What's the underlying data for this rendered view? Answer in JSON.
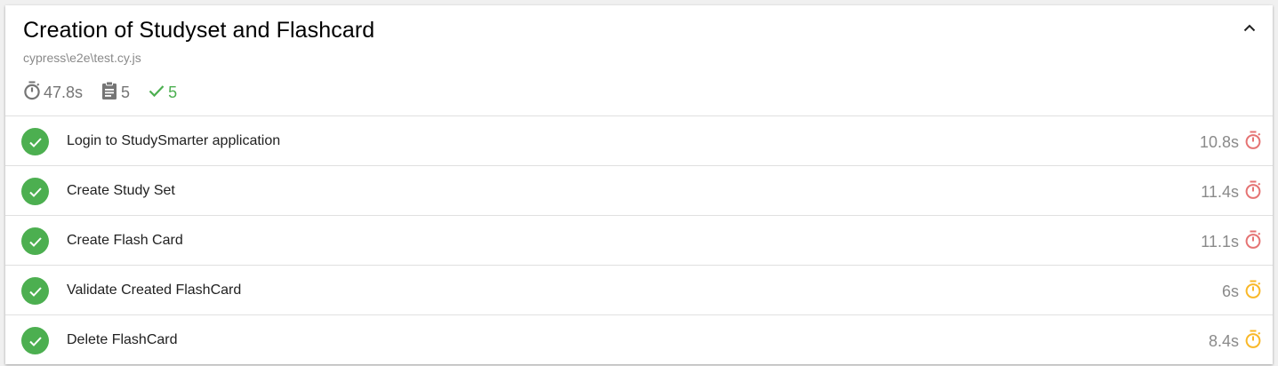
{
  "suite": {
    "title": "Creation of Studyset and Flashcard",
    "file": "cypress\\e2e\\test.cy.js",
    "duration": "47.8s",
    "test_count": "5",
    "passed_count": "5"
  },
  "colors": {
    "pass": "#4caf50",
    "slow": "#e57373",
    "medium": "#f9b828",
    "muted": "#757575"
  },
  "tests": [
    {
      "title": "Login to StudySmarter application",
      "duration": "10.8s",
      "speed": "slow"
    },
    {
      "title": "Create Study Set",
      "duration": "11.4s",
      "speed": "slow"
    },
    {
      "title": "Create Flash Card",
      "duration": "11.1s",
      "speed": "slow"
    },
    {
      "title": "Validate Created FlashCard",
      "duration": "6s",
      "speed": "medium"
    },
    {
      "title": "Delete FlashCard",
      "duration": "8.4s",
      "speed": "medium"
    }
  ]
}
